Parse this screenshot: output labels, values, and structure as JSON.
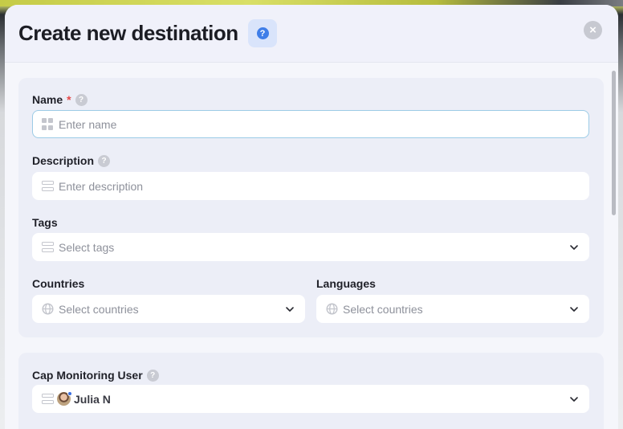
{
  "modal": {
    "title": "Create new destination",
    "help_symbol": "?",
    "close_symbol": "×"
  },
  "form": {
    "name": {
      "label": "Name",
      "required_mark": "*",
      "placeholder": "Enter name",
      "value": ""
    },
    "description": {
      "label": "Description",
      "placeholder": "Enter description",
      "value": ""
    },
    "tags": {
      "label": "Tags",
      "placeholder": "Select tags"
    },
    "countries": {
      "label": "Countries",
      "placeholder": "Select countries"
    },
    "languages": {
      "label": "Languages",
      "placeholder": "Select countries"
    },
    "cap_monitoring_user": {
      "label": "Cap Monitoring User",
      "value": "Julia N"
    }
  },
  "icons": {
    "help": "question-circle-icon",
    "close": "close-icon",
    "name_field": "grid-icon",
    "text_field": "list-icon",
    "globe": "globe-icon",
    "dropdown": "chevron-down-icon"
  },
  "colors": {
    "accent": "#3f7ee8",
    "required": "#e54848",
    "focus_border": "#9ccbe6",
    "status_online": "#3b6fe0"
  }
}
